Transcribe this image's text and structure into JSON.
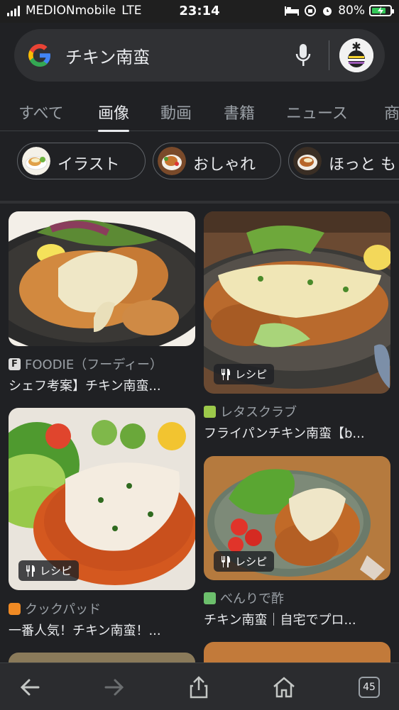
{
  "status": {
    "carrier": "MEDIONmobile",
    "network": "LTE",
    "time": "23:14",
    "battery_level": "80%",
    "battery_fraction": 0.8,
    "icons": [
      "bed-icon",
      "orientation-lock-icon",
      "alarm-icon",
      "charging-bolt-icon"
    ]
  },
  "search": {
    "query": "チキン南蛮",
    "icons": [
      "google-logo-icon",
      "microphone-icon",
      "profile-avatar-icon"
    ]
  },
  "tabs": [
    "すべて",
    "画像",
    "動画",
    "書籍",
    "ニュース",
    "商"
  ],
  "active_tab": "画像",
  "chips": [
    {
      "label": "イラスト"
    },
    {
      "label": "おしゃれ"
    },
    {
      "label": "ほっと も"
    }
  ],
  "results": {
    "recipe_label": "レシピ",
    "items": [
      {
        "source": "FOODIE（フーディー）",
        "title": "シェフ考案】チキン南蛮...",
        "recipe": false
      },
      {
        "source": "レタスクラブ",
        "title": "フライパンチキン南蛮【b...",
        "recipe": true
      },
      {
        "source": "クックパッド",
        "title": "一番人気！チキン南蛮！...",
        "recipe": true
      },
      {
        "source": "べんりで酢",
        "title": "チキン南蛮｜自宅でプロ...",
        "recipe": true
      }
    ]
  },
  "bottom": {
    "tab_count": "45",
    "icons": [
      "back-arrow-icon",
      "forward-arrow-icon",
      "share-icon",
      "home-icon",
      "tabs-icon"
    ]
  },
  "colors": {
    "background": "#202124",
    "search_bar": "#303134",
    "text": "#e8eaed",
    "muted": "#9aa0a6",
    "battery_green": "#34c759"
  }
}
